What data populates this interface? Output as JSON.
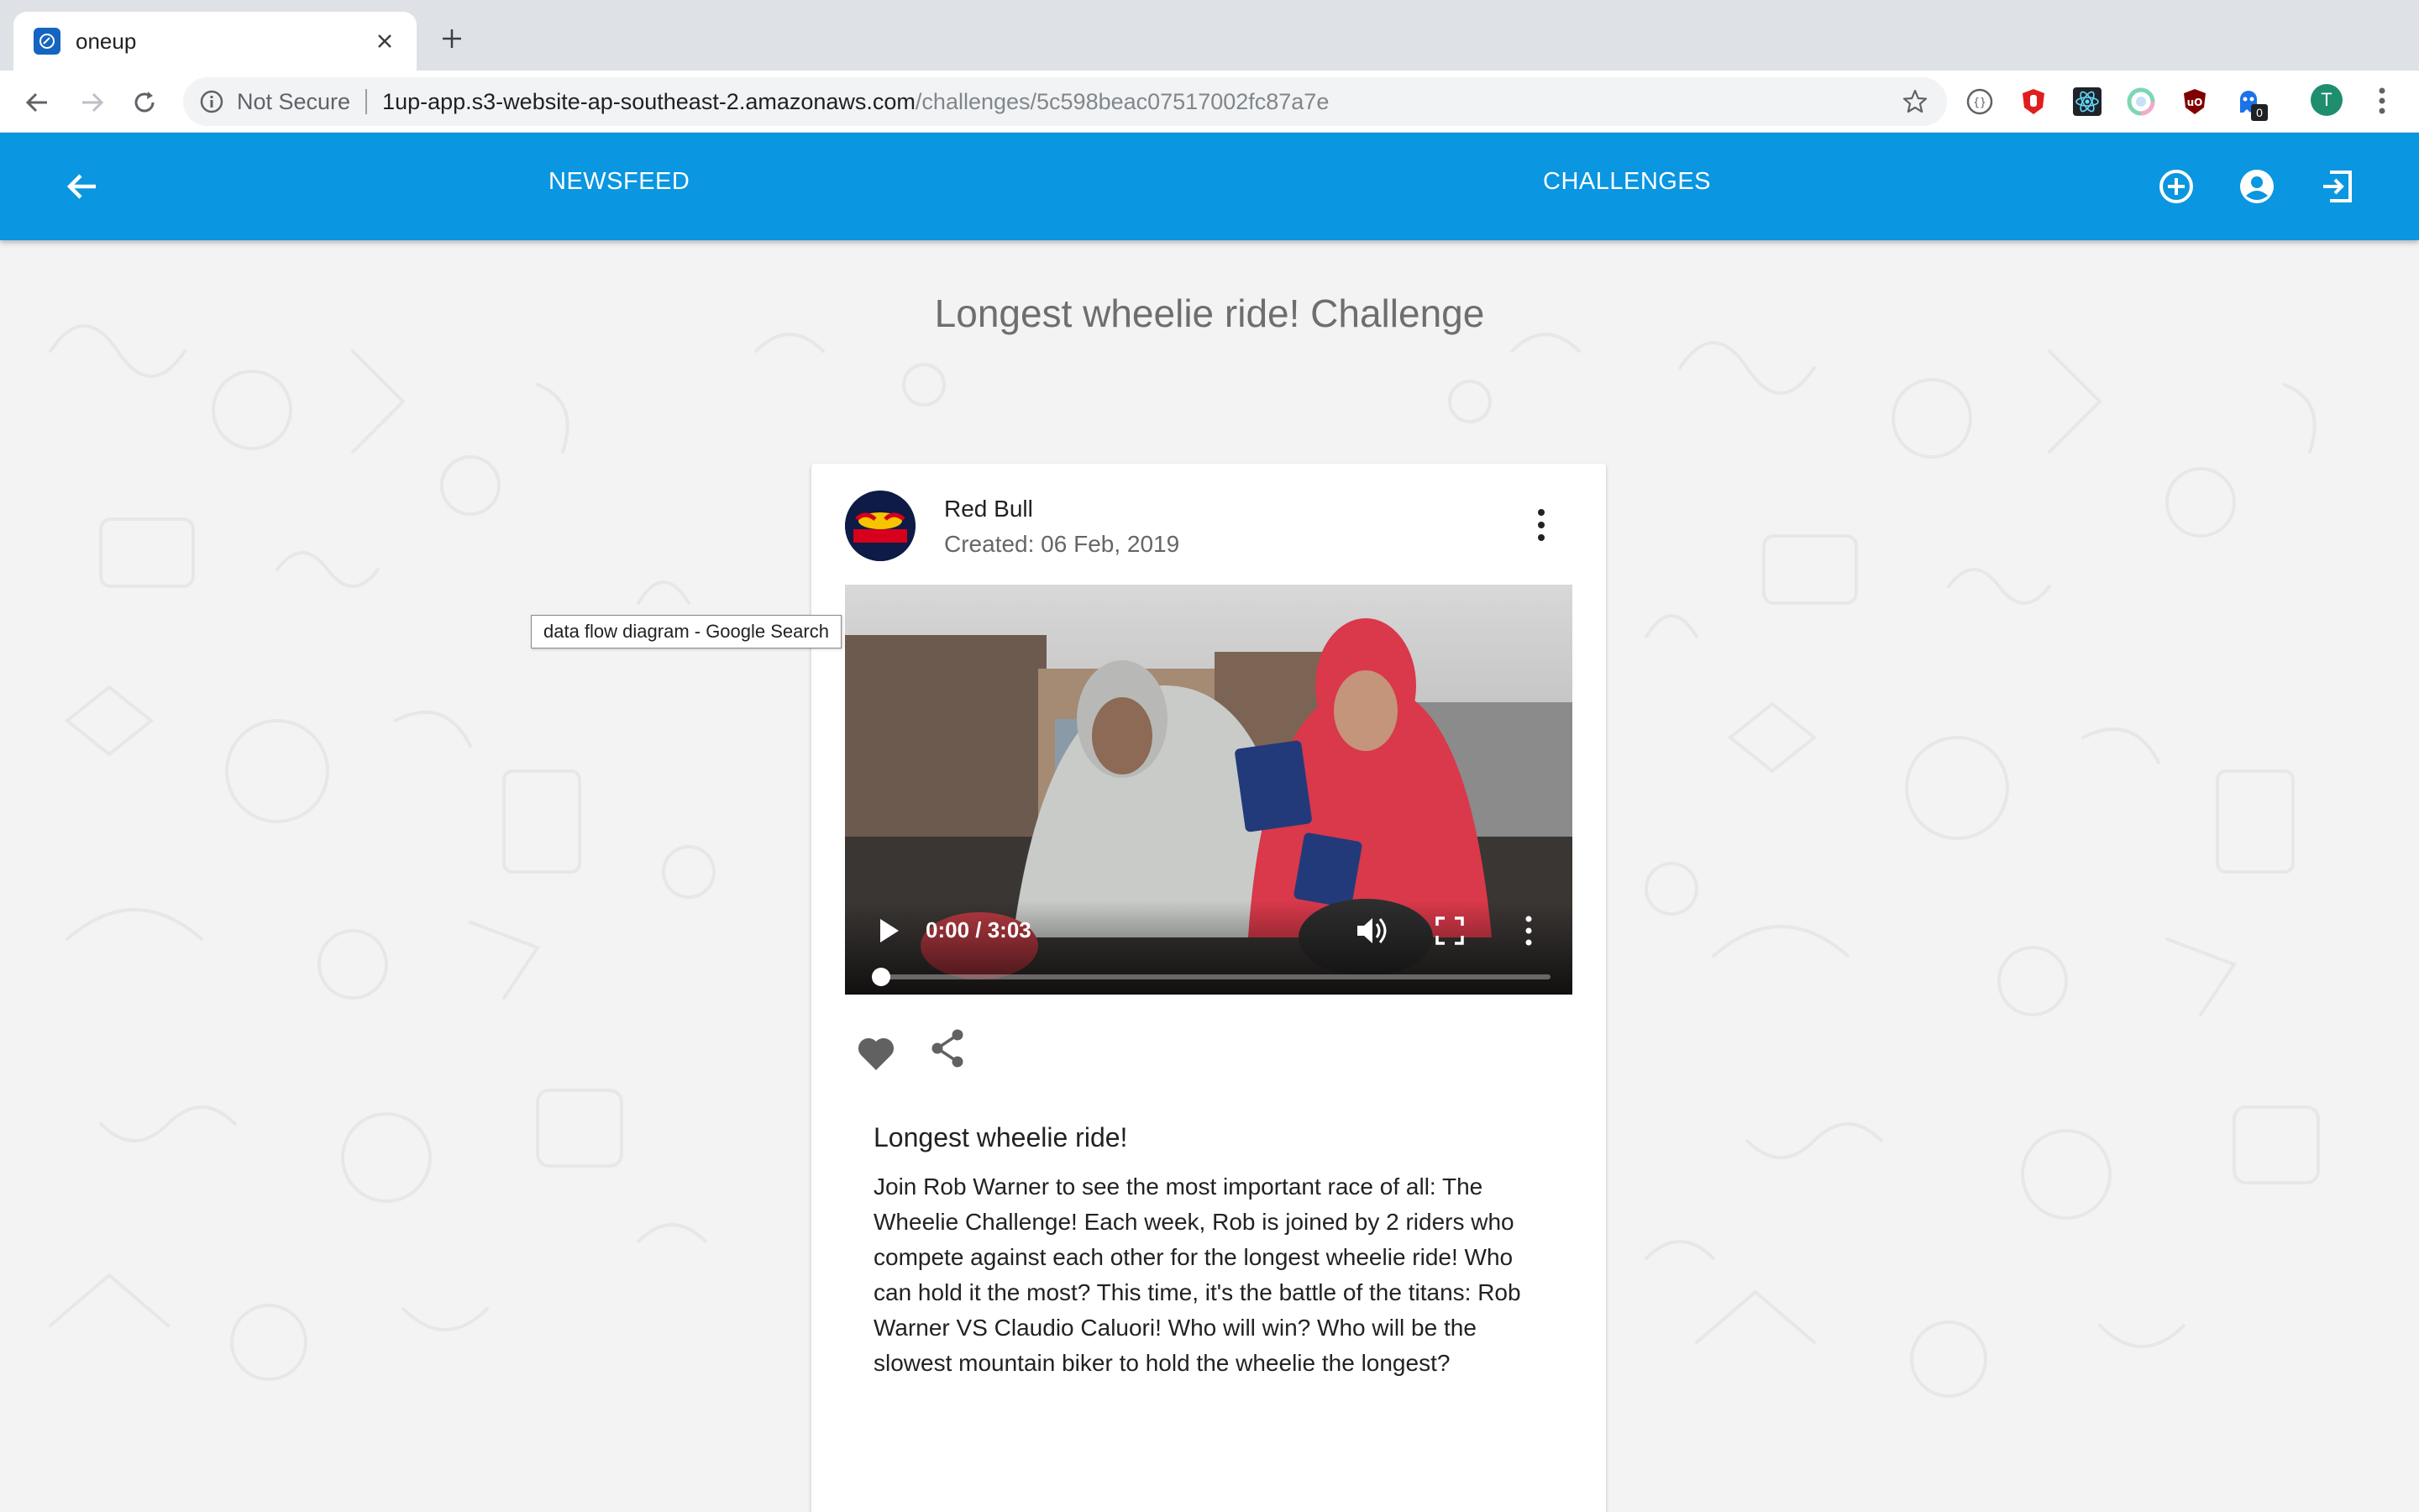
{
  "browser": {
    "tab_title": "oneup",
    "security_label": "Not Secure",
    "url_host": "1up-app.s3-website-ap-southeast-2.amazonaws.com",
    "url_path": "/challenges/5c598beac07517002fc87a7e",
    "profile_initial": "T",
    "extension_badge_count": "0",
    "tooltip_text": "data flow diagram - Google Search"
  },
  "appbar": {
    "newsfeed_label": "NEWSFEED",
    "challenges_label": "CHALLENGES",
    "color": "#0a96e0"
  },
  "page": {
    "title": "Longest wheelie ride! Challenge"
  },
  "post": {
    "author": "Red Bull",
    "created": "Created: 06 Feb, 2019",
    "video": {
      "time": "0:00 / 3:03",
      "progress": 0
    },
    "title": "Longest wheelie ride!",
    "body": "Join Rob Warner to see the most important race of all: The Wheelie Challenge! Each week, Rob is joined by 2 riders who compete against each other for the longest wheelie ride! Who can hold it the most? This time, it's the battle of the titans: Rob Warner VS Claudio Caluori! Who will win? Who will be the slowest mountain biker to hold the wheelie the longest?"
  },
  "icons": {
    "back": "arrow-left-icon",
    "add": "add-circle-icon",
    "account": "account-circle-icon",
    "logout": "exit-icon",
    "like": "heart-icon",
    "share": "share-icon"
  }
}
